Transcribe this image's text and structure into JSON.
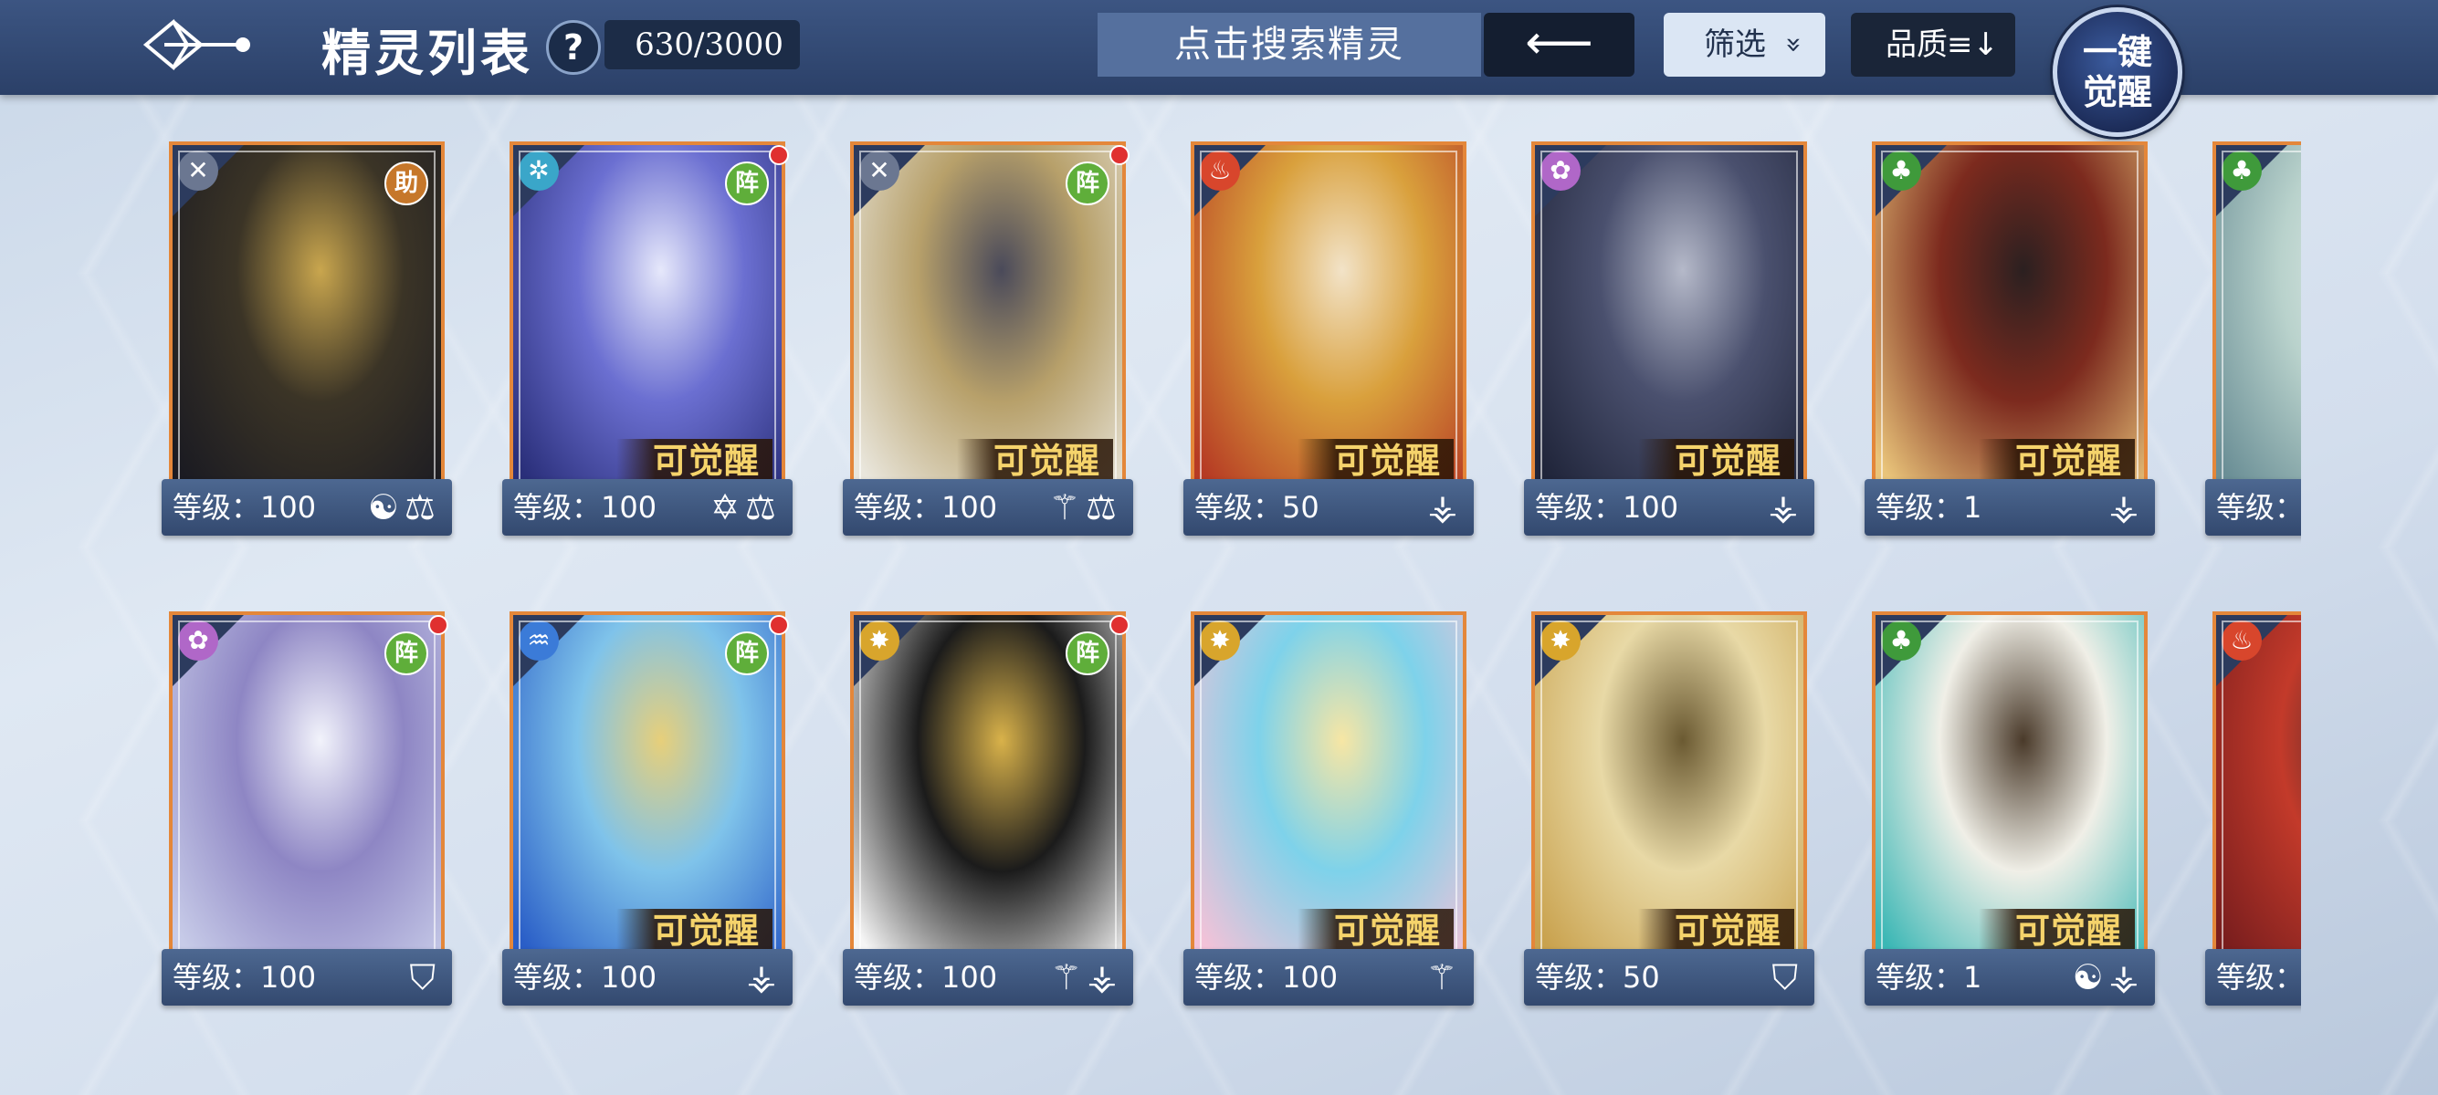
{
  "header": {
    "title": "精灵列表",
    "help_icon": "?",
    "count": "630/3000",
    "search_placeholder": "点击搜索精灵",
    "back_icon": "⟵",
    "filter_label": "筛选",
    "filter_icon": "»",
    "quality_label": "品质",
    "sort_icon": "≡↓",
    "awaken_label": "一键\n觉醒"
  },
  "cards": [
    {
      "level": "等级：100",
      "element": "✕",
      "elem_color": "#6b7791",
      "role": "助",
      "role_type": "zhu",
      "dot": false,
      "awaken": "",
      "classes": "☯⚖",
      "bg": [
        "#1b1b22",
        "#3b3426",
        "#c9a64e"
      ]
    },
    {
      "level": "等级：100",
      "element": "✲",
      "elem_color": "#3aa6c9",
      "role": "阵",
      "role_type": "zhen",
      "dot": true,
      "awaken": "可觉醒",
      "classes": "✡⚖",
      "bg": [
        "#2a2f7a",
        "#6b6fd1",
        "#e6e8fb"
      ]
    },
    {
      "level": "等级：100",
      "element": "✕",
      "elem_color": "#6b7791",
      "role": "阵",
      "role_type": "zhen",
      "dot": true,
      "awaken": "可觉醒",
      "classes": "⚚⚖",
      "bg": [
        "#e9e6dc",
        "#b7a06a",
        "#4a4a5a"
      ]
    },
    {
      "level": "等级：50",
      "element": "♨",
      "elem_color": "#d8462c",
      "role": "",
      "role_type": "",
      "dot": false,
      "awaken": "可觉醒",
      "classes": "⚶",
      "bg": [
        "#b63b24",
        "#d9a03c",
        "#f2e3c8"
      ]
    },
    {
      "level": "等级：100",
      "element": "✿",
      "elem_color": "#b067c8",
      "role": "",
      "role_type": "",
      "dot": false,
      "awaken": "可觉醒",
      "classes": "⚶",
      "bg": [
        "#20253a",
        "#4a506e",
        "#b5b9c9"
      ]
    },
    {
      "level": "等级：1",
      "element": "♣",
      "elem_color": "#3f9a3b",
      "role": "",
      "role_type": "",
      "dot": false,
      "awaken": "可觉醒",
      "classes": "⚶",
      "bg": [
        "#e9c47a",
        "#7c2a1e",
        "#2b2020"
      ]
    },
    {
      "level": "等级：",
      "element": "♣",
      "elem_color": "#3f9a3b",
      "role": "",
      "role_type": "",
      "dot": false,
      "awaken": "",
      "classes": "",
      "bg": [
        "#6b8f96",
        "#b9d2cc",
        "#e0ebe8"
      ]
    },
    {
      "level": "等级：100",
      "element": "✿",
      "elem_color": "#b067c8",
      "role": "阵",
      "role_type": "zhen",
      "dot": true,
      "awaken": "",
      "classes": "⛉",
      "bg": [
        "#c7cbe8",
        "#8e86c4",
        "#f2f3fb"
      ]
    },
    {
      "level": "等级：100",
      "element": "♒",
      "elem_color": "#3b7bd8",
      "role": "阵",
      "role_type": "zhen",
      "dot": true,
      "awaken": "可觉醒",
      "classes": "⚶",
      "bg": [
        "#2a5ec7",
        "#7fc3ea",
        "#e7cf7a"
      ]
    },
    {
      "level": "等级：100",
      "element": "✸",
      "elem_color": "#d8a52c",
      "role": "阵",
      "role_type": "zhen",
      "dot": true,
      "awaken": "",
      "classes": "⚚⚶",
      "bg": [
        "#f5f5f5",
        "#1b1b1b",
        "#d9b24a"
      ]
    },
    {
      "level": "等级：100",
      "element": "✸",
      "elem_color": "#d8a52c",
      "role": "",
      "role_type": "",
      "dot": false,
      "awaken": "可觉醒",
      "classes": "⚚",
      "bg": [
        "#f2c2d8",
        "#7ed2ea",
        "#f7e6a4"
      ]
    },
    {
      "level": "等级：50",
      "element": "✸",
      "elem_color": "#d8a52c",
      "role": "",
      "role_type": "",
      "dot": false,
      "awaken": "可觉醒",
      "classes": "⛉",
      "bg": [
        "#c9a24e",
        "#e8d9a6",
        "#6b5a32"
      ]
    },
    {
      "level": "等级：1",
      "element": "♣",
      "elem_color": "#3f9a3b",
      "role": "",
      "role_type": "",
      "dot": false,
      "awaken": "可觉醒",
      "classes": "☯⚶",
      "bg": [
        "#3bb7b5",
        "#f0efe7",
        "#4a3a2a"
      ]
    },
    {
      "level": "等级：",
      "element": "♨",
      "elem_color": "#d8462c",
      "role": "",
      "role_type": "",
      "dot": false,
      "awaken": "",
      "classes": "",
      "bg": [
        "#7a1e1e",
        "#c33a2a",
        "#3b2a2a"
      ]
    }
  ]
}
